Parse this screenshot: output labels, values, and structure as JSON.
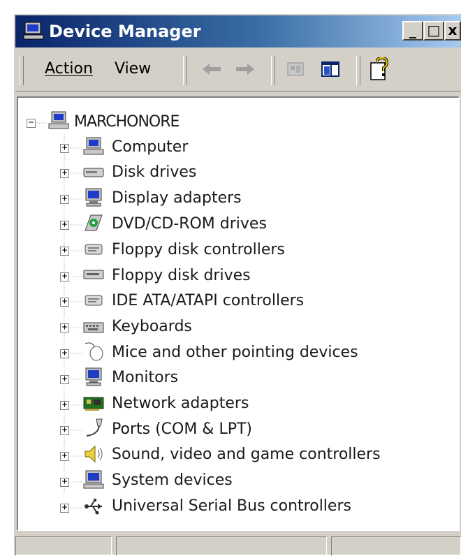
{
  "window": {
    "title": "Device Manager",
    "controls": {
      "minimize": "_",
      "maximize": "□",
      "close": "x"
    }
  },
  "toolbar": {
    "menus": [
      "Action",
      "View"
    ],
    "icons": [
      "back-arrow-icon",
      "forward-arrow-icon",
      "properties-icon",
      "show-hide-tree-icon",
      "help-icon"
    ]
  },
  "tree": {
    "root": {
      "label": "MARCHONORE",
      "icon": "computer-icon",
      "expander": "−"
    },
    "items": [
      {
        "label": "Computer",
        "icon": "computer-icon",
        "expander": "+"
      },
      {
        "label": "Disk drives",
        "icon": "disk-drive-icon",
        "expander": "+"
      },
      {
        "label": "Display adapters",
        "icon": "display-adapter-icon",
        "expander": "+"
      },
      {
        "label": "DVD/CD-ROM drives",
        "icon": "cdrom-icon",
        "expander": "+"
      },
      {
        "label": "Floppy disk controllers",
        "icon": "controller-icon",
        "expander": "+"
      },
      {
        "label": "Floppy disk drives",
        "icon": "floppy-drive-icon",
        "expander": "+"
      },
      {
        "label": "IDE ATA/ATAPI controllers",
        "icon": "controller-icon",
        "expander": "+"
      },
      {
        "label": "Keyboards",
        "icon": "keyboard-icon",
        "expander": "+"
      },
      {
        "label": "Mice and other pointing devices",
        "icon": "mouse-icon",
        "expander": "+"
      },
      {
        "label": "Monitors",
        "icon": "monitor-icon",
        "expander": "+"
      },
      {
        "label": "Network adapters",
        "icon": "network-adapter-icon",
        "expander": "+"
      },
      {
        "label": "Ports (COM & LPT)",
        "icon": "port-icon",
        "expander": "+"
      },
      {
        "label": "Sound, video and game controllers",
        "icon": "speaker-icon",
        "expander": "+"
      },
      {
        "label": "System devices",
        "icon": "system-device-icon",
        "expander": "+"
      },
      {
        "label": "Universal Serial Bus controllers",
        "icon": "usb-icon",
        "expander": "+"
      }
    ]
  },
  "statusbar": {
    "panes": [
      "",
      "",
      ""
    ]
  }
}
